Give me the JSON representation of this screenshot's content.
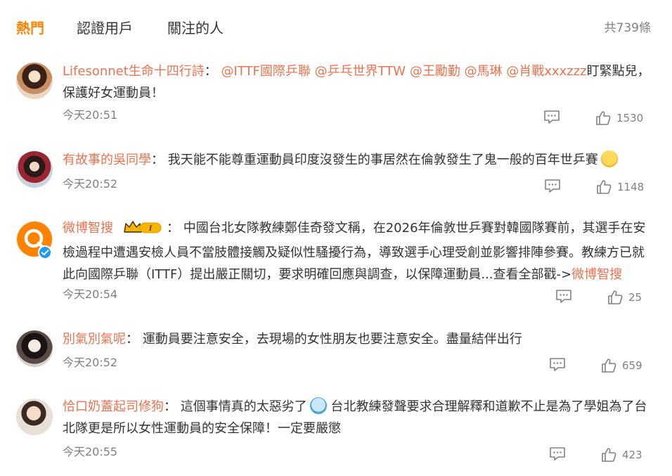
{
  "tabs": {
    "hot": "熱門",
    "verified": "認證用戶",
    "following": "關注的人"
  },
  "total": "共739條",
  "comments": [
    {
      "user": "Lifesonnet生命十四行詩",
      "sep": "：",
      "mentions": [
        "@ITTF國際乒聯",
        "@乒乓世界TTW",
        "@王勵勤",
        "@馬琳",
        "@肖戰xxxzzz"
      ],
      "tail": "盯緊點兒，保護好女運動員！",
      "time": "今天20:51",
      "likes": "1530"
    },
    {
      "user": "有故事的吳同學",
      "sep": "：",
      "text": "我天能不能尊重運動員印度沒發生的事居然在倫敦發生了鬼一般的百年世乒賽",
      "emoji": "thinking-emoji",
      "time": "今天20:52",
      "likes": "1148"
    },
    {
      "user": "微博智搜",
      "badge_level": "I",
      "sep": "：",
      "text": "中國台北女隊教練鄭佳奇發文稱，在2026年倫敦世乒賽對韓國隊賽前，其選手在安檢過程中遭遇安檢人員不當肢體接觸及疑似性騷擾行為，導致選手心理受創並影響排陣參賽。教練方已就此向國際乒聯（ITTF）提出嚴正關切，要求明確回應與調查，以保障運動員...",
      "more": "查看全部戳->",
      "more_link": "微博智搜",
      "time": "今天20:54",
      "likes": "25"
    },
    {
      "user": "別氣別氣呢",
      "sep": "：",
      "text": "運動員要注意安全，去現場的女性朋友也要注意安全。盡量結伴出行",
      "time": "今天20:52",
      "likes": "659"
    },
    {
      "user": "恰口奶蓋起司修狗",
      "sep": "：",
      "text_a": "這個事情真的太惡劣了",
      "emoji": "sweating-emoji",
      "text_b": "台北教練發聲要求合理解釋和道歉不止是為了學姐為了台北隊更是所以女性運動員的安全保障！一定要嚴懲",
      "time": "今天20:55",
      "likes": "423"
    }
  ],
  "colors": {
    "accent": "#ff8200",
    "username": "#eb7350",
    "muted": "#808080",
    "verified_blue": "#1d9bf0",
    "badge_gold": "#f7b500"
  }
}
